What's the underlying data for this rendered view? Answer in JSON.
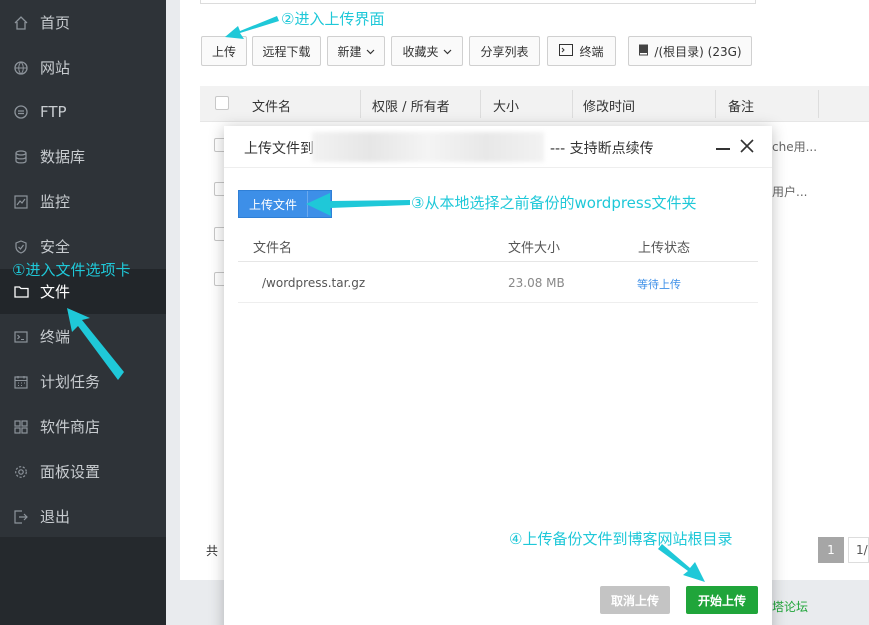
{
  "sidebar": {
    "items": [
      {
        "label": "首页",
        "icon": "home-icon"
      },
      {
        "label": "网站",
        "icon": "globe-icon"
      },
      {
        "label": "FTP",
        "icon": "ftp-icon"
      },
      {
        "label": "数据库",
        "icon": "database-icon"
      },
      {
        "label": "监控",
        "icon": "monitor-icon"
      },
      {
        "label": "安全",
        "icon": "shield-icon"
      },
      {
        "label": "文件",
        "icon": "folder-icon"
      },
      {
        "label": "终端",
        "icon": "terminal-icon"
      },
      {
        "label": "计划任务",
        "icon": "calendar-icon"
      },
      {
        "label": "软件商店",
        "icon": "grid-icon"
      },
      {
        "label": "面板设置",
        "icon": "gear-icon"
      },
      {
        "label": "退出",
        "icon": "logout-icon"
      }
    ],
    "active": "文件"
  },
  "toolbar": {
    "upload": "上传",
    "remote_download": "远程下载",
    "new": "新建",
    "favorites": "收藏夹",
    "share_list": "分享列表",
    "terminal": "终端",
    "disk": "/(根目录) (23G)"
  },
  "file_table": {
    "headers": [
      "文件名",
      "权限 / 所有者",
      "大小",
      "修改时间",
      "备注"
    ],
    "partial_notes": [
      "che用...",
      "用户..."
    ],
    "total_prefix": "共",
    "pager_current": "1",
    "pager_next": "1/"
  },
  "modal": {
    "title_prefix": "上传文件到",
    "title_suffix": "--- 支持断点续传",
    "upload_button": "上传文件",
    "headers": [
      "文件名",
      "文件大小",
      "上传状态"
    ],
    "files": [
      {
        "name": "/wordpress.tar.gz",
        "size": "23.08 MB",
        "status": "等待上传"
      }
    ],
    "cancel_button": "取消上传",
    "start_button": "开始上传"
  },
  "footer_link": "宝塔论坛",
  "annotations": {
    "step1": "①进入文件选项卡",
    "step2": "②进入上传界面",
    "step3": "③从本地选择之前备份的wordpress文件夹",
    "step4": "④上传备份文件到博客网站根目录"
  },
  "colors": {
    "sidebar_bg": "#2e3338",
    "annotation": "#1fc8d8",
    "primary_blue": "#3d8fe8",
    "success_green": "#20a53a",
    "status_blue": "#3d8fe8"
  }
}
